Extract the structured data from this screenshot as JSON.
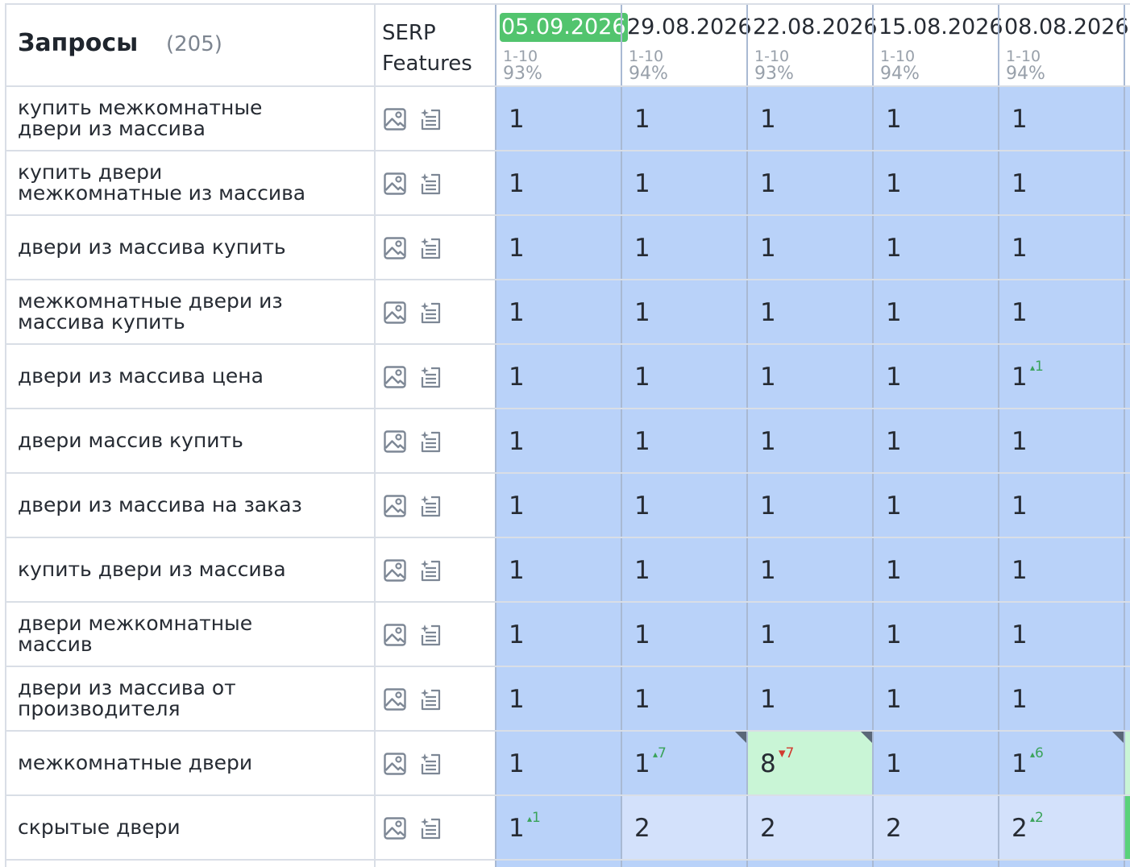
{
  "header": {
    "title": "Запросы",
    "count": "(205)",
    "serp_line1": "SERP",
    "serp_line2": "Features"
  },
  "dates": [
    {
      "label": "05.09.2026",
      "range": "1-10",
      "pct": "93%",
      "current": true
    },
    {
      "label": "29.08.2026",
      "range": "1-10",
      "pct": "94%",
      "current": false
    },
    {
      "label": "22.08.2026",
      "range": "1-10",
      "pct": "93%",
      "current": false
    },
    {
      "label": "15.08.2026",
      "range": "1-10",
      "pct": "94%",
      "current": false
    },
    {
      "label": "08.08.2026",
      "range": "1-10",
      "pct": "94%",
      "current": false
    }
  ],
  "icons": [
    "image-icon",
    "list-sparkle-icon"
  ],
  "colors": {
    "top_position": "#b9d2f9",
    "position_2": "#d3e1fb",
    "improved": "#c9f5d6",
    "current_badge": "#52c46e",
    "delta_up": "#3aa35a",
    "delta_down": "#d23a2f"
  },
  "rows": [
    {
      "keyword": [
        "купить межкомнатные",
        "двери из массива"
      ],
      "positions": [
        {
          "v": "1"
        },
        {
          "v": "1"
        },
        {
          "v": "1"
        },
        {
          "v": "1"
        },
        {
          "v": "1"
        }
      ]
    },
    {
      "keyword": [
        "купить двери",
        "межкомнатные из массива"
      ],
      "positions": [
        {
          "v": "1"
        },
        {
          "v": "1"
        },
        {
          "v": "1"
        },
        {
          "v": "1"
        },
        {
          "v": "1"
        }
      ]
    },
    {
      "keyword": [
        "двери из массива купить"
      ],
      "positions": [
        {
          "v": "1"
        },
        {
          "v": "1"
        },
        {
          "v": "1"
        },
        {
          "v": "1"
        },
        {
          "v": "1"
        }
      ]
    },
    {
      "keyword": [
        "межкомнатные двери из",
        "массива купить"
      ],
      "positions": [
        {
          "v": "1"
        },
        {
          "v": "1"
        },
        {
          "v": "1"
        },
        {
          "v": "1"
        },
        {
          "v": "1"
        }
      ]
    },
    {
      "keyword": [
        "двери из массива цена"
      ],
      "positions": [
        {
          "v": "1"
        },
        {
          "v": "1"
        },
        {
          "v": "1"
        },
        {
          "v": "1"
        },
        {
          "v": "1",
          "d": "1",
          "dir": "up"
        }
      ]
    },
    {
      "keyword": [
        "двери массив купить"
      ],
      "positions": [
        {
          "v": "1"
        },
        {
          "v": "1"
        },
        {
          "v": "1"
        },
        {
          "v": "1"
        },
        {
          "v": "1"
        }
      ]
    },
    {
      "keyword": [
        "двери из массива на заказ"
      ],
      "positions": [
        {
          "v": "1"
        },
        {
          "v": "1"
        },
        {
          "v": "1"
        },
        {
          "v": "1"
        },
        {
          "v": "1"
        }
      ]
    },
    {
      "keyword": [
        "купить двери из массива"
      ],
      "positions": [
        {
          "v": "1"
        },
        {
          "v": "1"
        },
        {
          "v": "1"
        },
        {
          "v": "1"
        },
        {
          "v": "1"
        }
      ]
    },
    {
      "keyword": [
        "двери межкомнатные",
        "массив"
      ],
      "positions": [
        {
          "v": "1"
        },
        {
          "v": "1"
        },
        {
          "v": "1"
        },
        {
          "v": "1"
        },
        {
          "v": "1"
        }
      ]
    },
    {
      "keyword": [
        "двери из массива от",
        "производителя"
      ],
      "positions": [
        {
          "v": "1"
        },
        {
          "v": "1"
        },
        {
          "v": "1"
        },
        {
          "v": "1"
        },
        {
          "v": "1"
        }
      ]
    },
    {
      "keyword": [
        "межкомнатные двери"
      ],
      "positions": [
        {
          "v": "1"
        },
        {
          "v": "1",
          "d": "7",
          "dir": "up",
          "corner": true
        },
        {
          "v": "8",
          "d": "7",
          "dir": "down",
          "corner": true,
          "bg": "improved"
        },
        {
          "v": "1"
        },
        {
          "v": "1",
          "d": "6",
          "dir": "up",
          "corner": true
        }
      ]
    },
    {
      "keyword": [
        "скрытые двери"
      ],
      "positions": [
        {
          "v": "1",
          "d": "1",
          "dir": "up"
        },
        {
          "v": "2"
        },
        {
          "v": "2"
        },
        {
          "v": "2"
        },
        {
          "v": "2",
          "d": "2",
          "dir": "up"
        }
      ]
    }
  ]
}
